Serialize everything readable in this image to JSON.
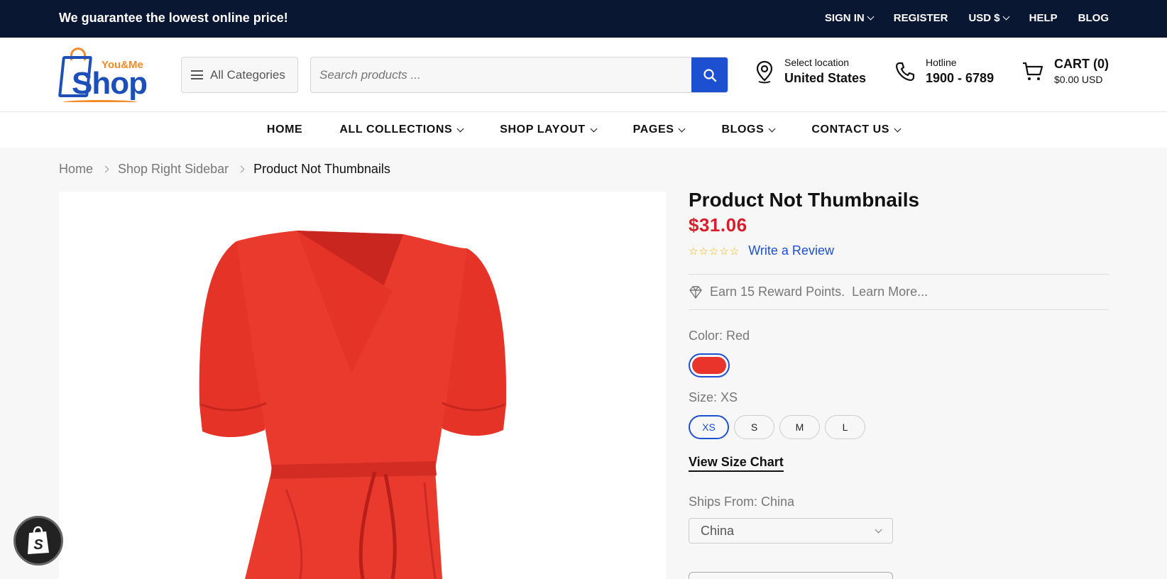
{
  "topbar": {
    "promo": "We guarantee the lowest online price!",
    "links": [
      "SIGN IN",
      "REGISTER",
      "USD $",
      "HELP",
      "BLOG"
    ]
  },
  "header": {
    "logo_top": "You&Me",
    "logo_main": "Shop",
    "categories_label": "All Categories",
    "search_placeholder": "Search products ...",
    "location_label": "Select location",
    "location_value": "United States",
    "hotline_label": "Hotline",
    "hotline_value": "1900 - 6789",
    "cart_label": "CART (0)",
    "cart_total": "$0.00 USD"
  },
  "nav": {
    "items": [
      "HOME",
      "ALL COLLECTIONS",
      "SHOP LAYOUT",
      "PAGES",
      "BLOGS",
      "CONTACT US"
    ]
  },
  "breadcrumb": [
    "Home",
    "Shop Right Sidebar",
    "Product Not Thumbnails"
  ],
  "product": {
    "title": "Product Not Thumbnails",
    "price": "$31.06",
    "stars": "☆☆☆☆☆",
    "review_link": "Write a Review",
    "reward_text": "Earn 15 Reward Points.",
    "reward_link": "Learn More...",
    "color_label": "Color: Red",
    "color_hex": "#e8342b",
    "size_label": "Size: XS",
    "sizes": [
      "XS",
      "S",
      "M",
      "L"
    ],
    "size_chart_link": "View Size Chart",
    "ships_label": "Ships From: China",
    "ships_value": "China"
  },
  "colors": {
    "topbar_bg": "#0a1733",
    "accent_blue": "#1d4fd1",
    "price_red": "#d81e2a",
    "dress_red": "#e8342b"
  }
}
